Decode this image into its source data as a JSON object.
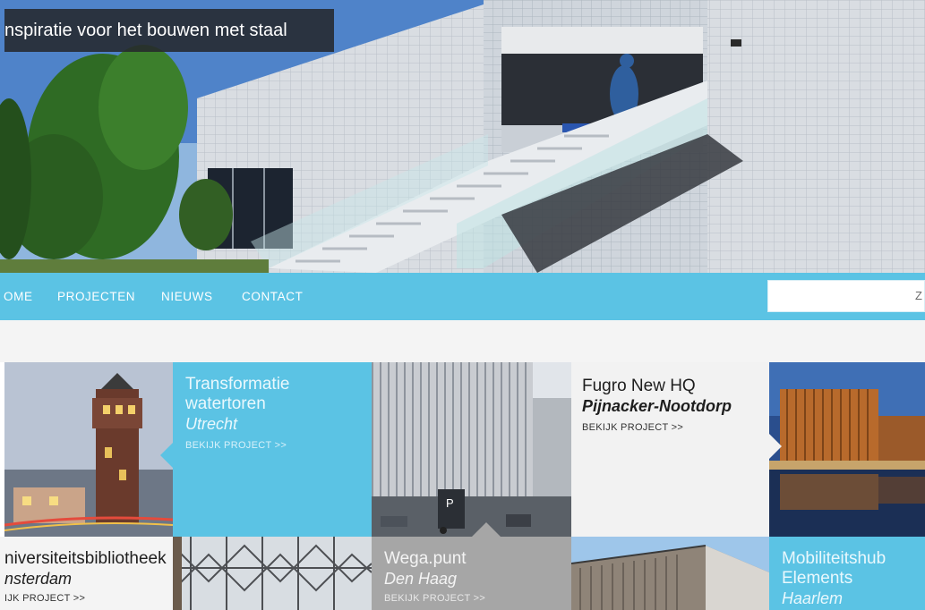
{
  "hero": {
    "tagline": "nspiratie voor het bouwen met staal"
  },
  "nav": {
    "items": [
      "OME",
      "PROJECTEN",
      "NIEUWS",
      "CONTACT"
    ]
  },
  "search": {
    "button_label": "Z",
    "value": ""
  },
  "projects": [
    {
      "title_lines": [
        "Transformatie",
        "watertoren"
      ],
      "city": "Utrecht",
      "link": "BEKIJK PROJECT >>"
    },
    {
      "title_lines": [
        "Fugro New HQ"
      ],
      "city": "Pijnacker-Nootdorp",
      "link": "BEKIJK PROJECT >>"
    },
    {
      "title_lines": [
        "niversiteitsbibliotheek"
      ],
      "city": "nsterdam",
      "link": "IJK PROJECT >>"
    },
    {
      "title_lines": [
        "Wega.punt"
      ],
      "city": "Den Haag",
      "link": "BEKIJK PROJECT >>"
    },
    {
      "title_lines": [
        "Mobiliteitshub",
        "Elements"
      ],
      "city": "Haarlem",
      "link": ""
    }
  ],
  "photo_overlay": {
    "parking_sign": "P"
  },
  "colors": {
    "accent_blue": "#5bc3e4",
    "tagline_bg": "#26282c",
    "grey_tile": "#f2f2f2",
    "dark_tile": "#a6a6a6"
  }
}
